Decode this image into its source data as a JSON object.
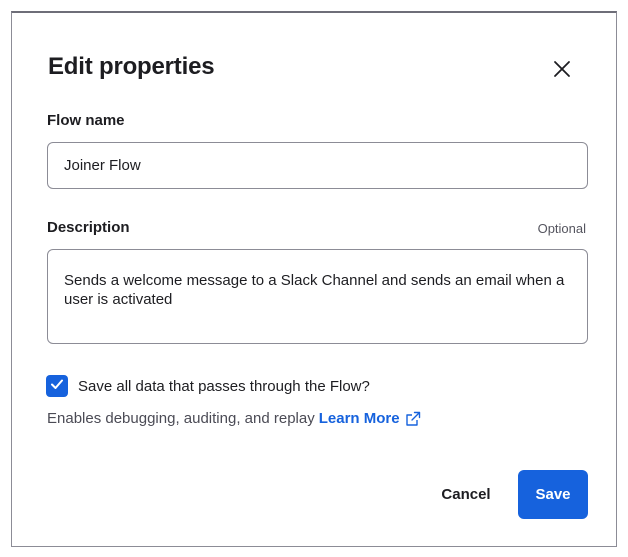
{
  "dialog": {
    "title": "Edit properties",
    "close_icon": "close-icon"
  },
  "flow_name": {
    "label": "Flow name",
    "value": "Joiner Flow"
  },
  "description": {
    "label": "Description",
    "optional_label": "Optional",
    "value": "Sends a welcome message to a Slack Channel and sends an email when a user is activated"
  },
  "save_data": {
    "checked": true,
    "label": "Save all data that passes through the Flow?",
    "help_text": "Enables debugging, auditing, and replay",
    "learn_more": "Learn More",
    "external_link_icon": "external-link-icon"
  },
  "actions": {
    "cancel_label": "Cancel",
    "save_label": "Save"
  },
  "colors": {
    "accent": "#1662dd",
    "border": "#8c8c96",
    "text": "#1d1d21"
  }
}
